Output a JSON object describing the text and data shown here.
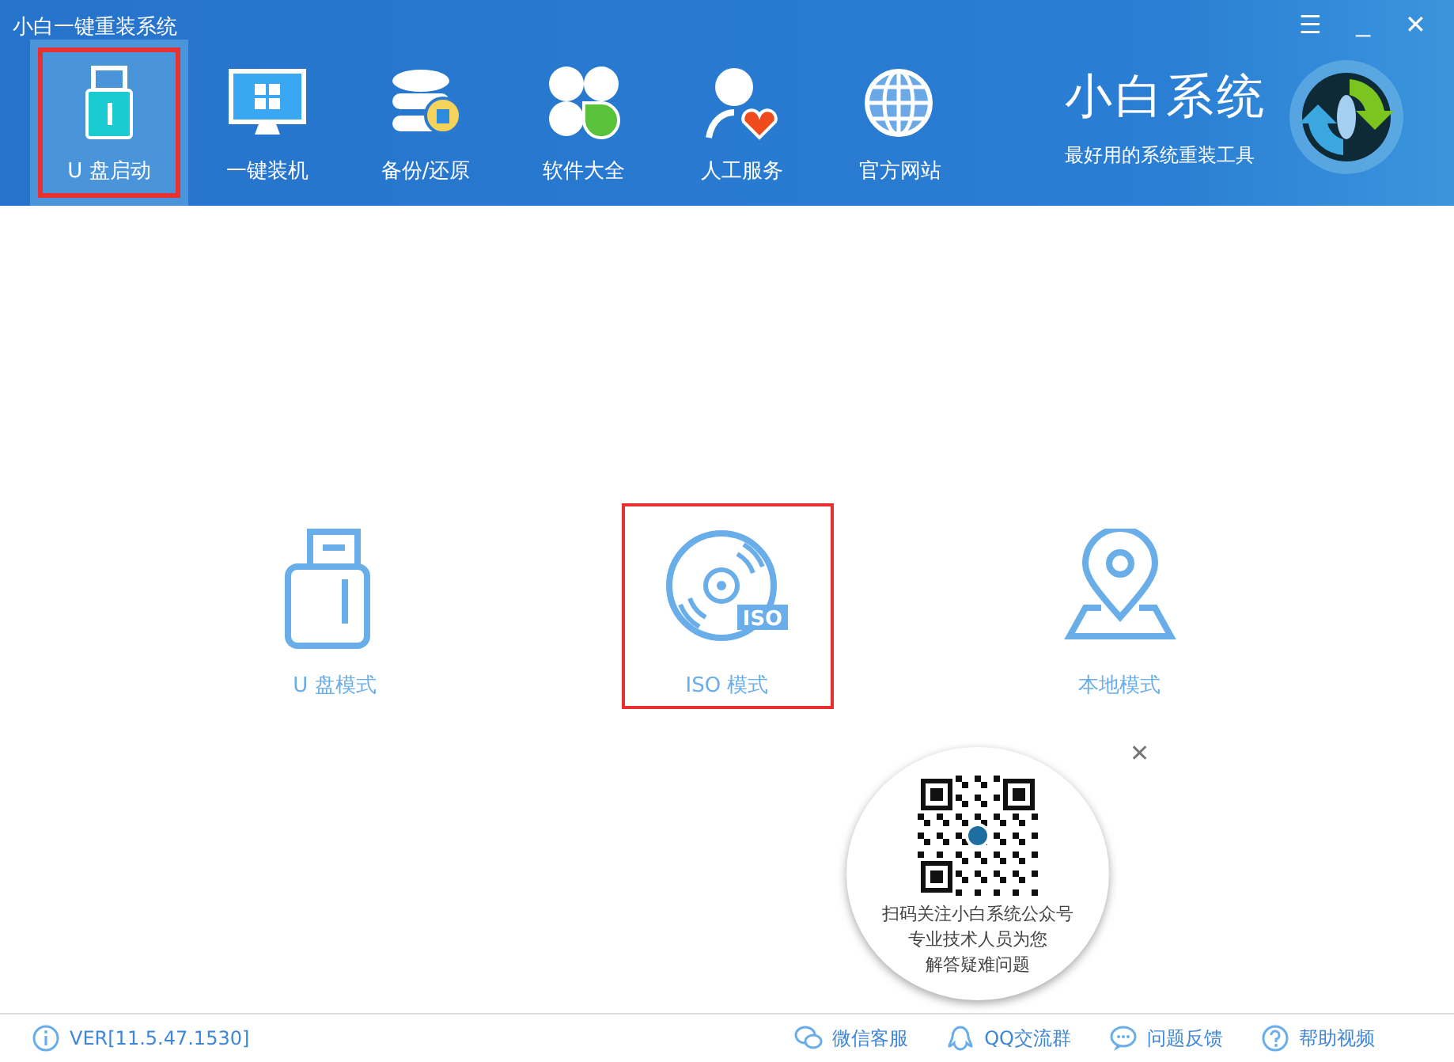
{
  "window": {
    "title": "小白一键重装系统",
    "controls": [
      "☰",
      "_",
      "✕"
    ]
  },
  "tabs": [
    {
      "label": "U 盘启动",
      "kind": "usb",
      "selected": true,
      "highlighted": true
    },
    {
      "label": "一键装机",
      "kind": "monitor",
      "selected": false,
      "highlighted": false
    },
    {
      "label": "备份/还原",
      "kind": "database",
      "selected": false,
      "highlighted": false
    },
    {
      "label": "软件大全",
      "kind": "clover",
      "selected": false,
      "highlighted": false
    },
    {
      "label": "人工服务",
      "kind": "person",
      "selected": false,
      "highlighted": false
    },
    {
      "label": "官方网站",
      "kind": "globe",
      "selected": false,
      "highlighted": false
    }
  ],
  "brand": {
    "name": "小白系统",
    "slogan": "最好用的系统重装工具"
  },
  "modes": [
    {
      "label": "U 盘模式",
      "kind": "usb",
      "highlighted": false
    },
    {
      "label": "ISO 模式",
      "kind": "disc",
      "badge": "ISO",
      "highlighted": true
    },
    {
      "label": "本地模式",
      "kind": "pin",
      "highlighted": false
    }
  ],
  "qr_popup": {
    "close": "✕",
    "lines": [
      "扫码关注小白系统公众号",
      "专业技术人员为您",
      "解答疑难问题"
    ]
  },
  "status_bar": {
    "version": "VER[11.5.47.1530]",
    "links": [
      {
        "label": "微信客服",
        "kind": "wechat"
      },
      {
        "label": "QQ交流群",
        "kind": "qq"
      },
      {
        "label": "问题反馈",
        "kind": "chat"
      },
      {
        "label": "帮助视频",
        "kind": "help"
      }
    ]
  }
}
